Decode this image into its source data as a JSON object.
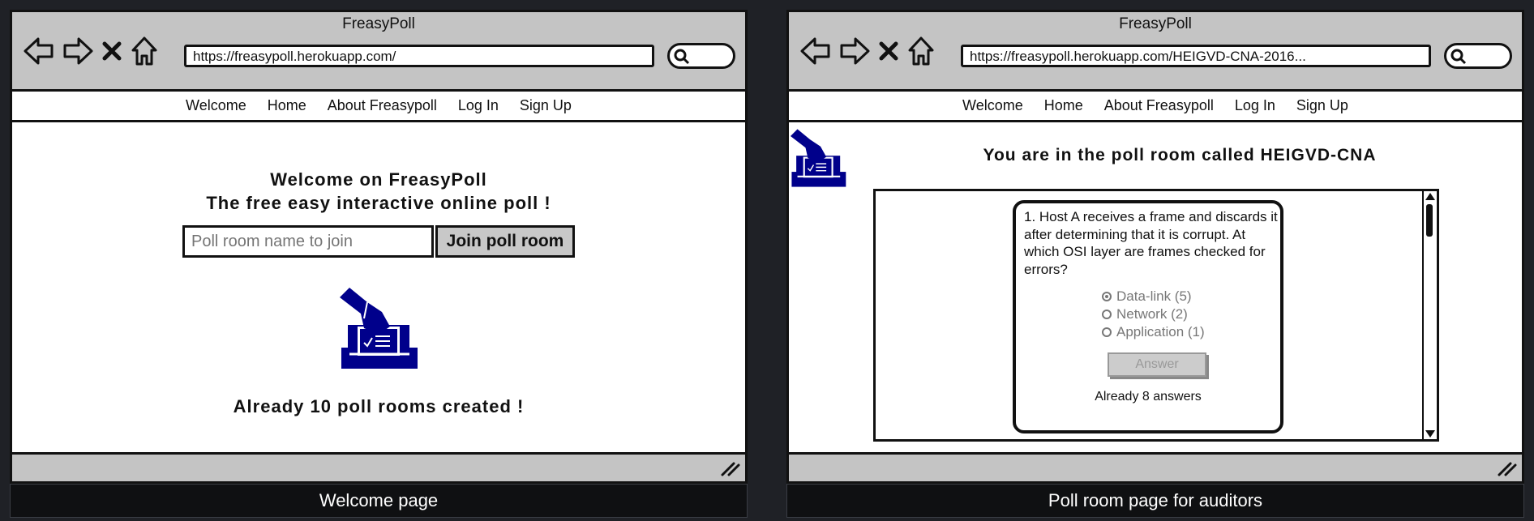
{
  "left": {
    "window_title": "FreasyPoll",
    "url": "https://freasypoll.herokuapp.com/",
    "menu": [
      "Welcome",
      "Home",
      "About Freasypoll",
      "Log In",
      "Sign Up"
    ],
    "welcome_line1": "Welcome on FreasyPoll",
    "welcome_line2": "The free easy interactive online poll !",
    "join_placeholder": "Poll room name to join",
    "join_button": "Join poll room",
    "created_text": "Already 10 poll rooms created !",
    "caption": "Welcome page"
  },
  "right": {
    "window_title": "FreasyPoll",
    "url": "https://freasypoll.herokuapp.com/HEIGVD-CNA-2016...",
    "menu": [
      "Welcome",
      "Home",
      "About Freasypoll",
      "Log In",
      "Sign Up"
    ],
    "room_title": "You are in the poll room called HEIGVD-CNA",
    "question": "1. Host A receives a frame and discards it after determining that it is corrupt. At which OSI layer are frames checked for errors?",
    "options": [
      "Data-link (5)",
      "Network (2)",
      "Application (1)"
    ],
    "selected_option": "Data-link (5)",
    "answer_button": "Answer",
    "answers_count": "Already 8 answers",
    "caption": "Poll room page for auditors"
  },
  "icons": {
    "back": "back-arrow-icon",
    "forward": "forward-arrow-icon",
    "stop": "close-icon",
    "home": "home-icon",
    "search": "search-icon",
    "logo": "ballot-box-icon",
    "resize": "resize-grip-icon"
  },
  "colors": {
    "logo_blue": "#00008b",
    "chrome_gray": "#c4c4c4",
    "background": "#1f2126"
  }
}
